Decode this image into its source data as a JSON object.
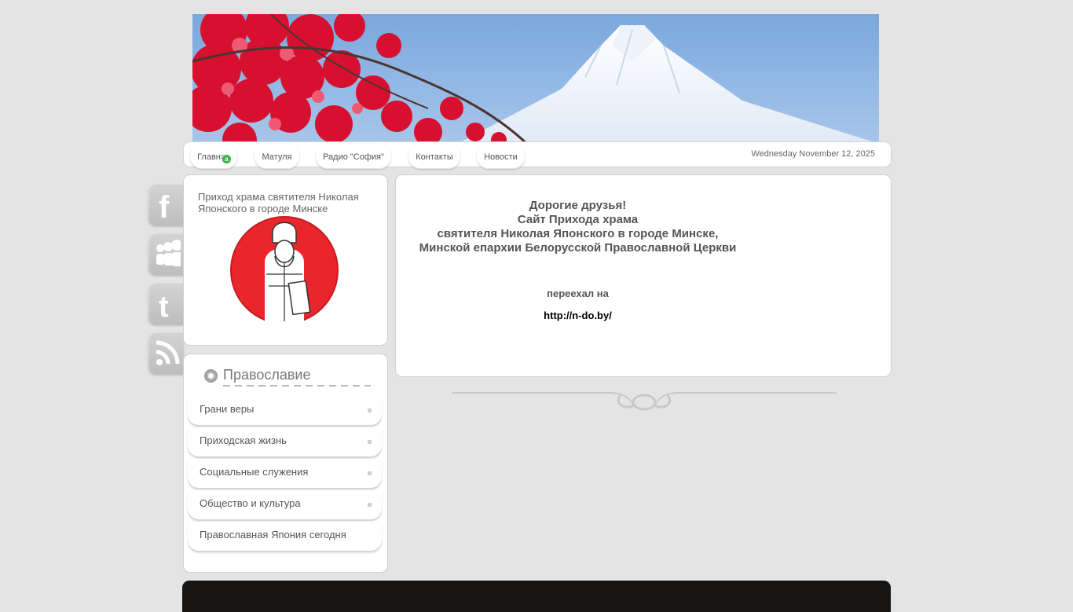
{
  "nav": {
    "tabs": [
      {
        "label": "Главная"
      },
      {
        "label": "Матуля"
      },
      {
        "label": "Радио \"София\""
      },
      {
        "label": "Контакты"
      },
      {
        "label": "Новости"
      }
    ],
    "badge": "а",
    "date": "Wednesday November 12, 2025"
  },
  "sidebar": {
    "parish_title": "Приход храма святителя Николая Японского в городе Минске",
    "section_title": "Православие",
    "menu": [
      {
        "label": "Грани веры"
      },
      {
        "label": "Приходская жизнь"
      },
      {
        "label": "Социальные служения"
      },
      {
        "label": "Общество и культура"
      },
      {
        "label": "Православная Япония сегодня"
      }
    ]
  },
  "social": [
    "facebook-icon",
    "myspace-icon",
    "twitter-icon",
    "rss-icon"
  ],
  "main": {
    "heading_lines": [
      "Дорогие друзья!",
      "Сайт Прихода храма",
      "святителя Николая Японского в городе Минске,",
      "Минской епархии Белорусской Православной Церкви"
    ],
    "moved_text": "переехал на",
    "link": "http://n-do.by/"
  },
  "colors": {
    "background": "#e4e4e4",
    "footer": "#161412",
    "logo_red": "#e8262b",
    "badge_green": "#3cb043"
  }
}
